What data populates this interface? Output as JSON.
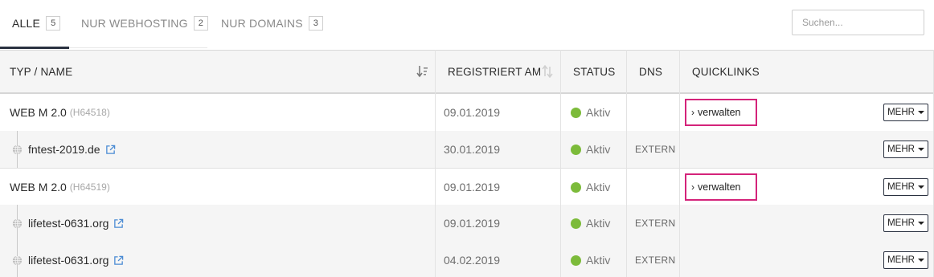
{
  "tabs": [
    {
      "label": "ALLE",
      "count": "5"
    },
    {
      "label": "NUR WEBHOSTING",
      "count": "2"
    },
    {
      "label": "NUR DOMAINS",
      "count": "3"
    }
  ],
  "search": {
    "placeholder": "Suchen..."
  },
  "columns": {
    "name": "TYP / NAME",
    "registered": "REGISTRIERT AM",
    "status": "STATUS",
    "dns": "DNS",
    "quicklinks": "QUICKLINKS"
  },
  "rows": [
    {
      "name": "WEB M 2.0",
      "code": "(H64518)",
      "date": "09.01.2019",
      "status": "Aktiv",
      "dns": "",
      "quicklink": "verwalten",
      "more": "MEHR"
    },
    {
      "name": "fntest-2019.de",
      "date": "30.01.2019",
      "status": "Aktiv",
      "dns": "EXTERN",
      "more": "MEHR"
    },
    {
      "name": "WEB M 2.0",
      "code": "(H64519)",
      "date": "09.01.2019",
      "status": "Aktiv",
      "dns": "",
      "quicklink": "verwalten",
      "more": "MEHR"
    },
    {
      "name": "lifetest-0631.org",
      "date": "09.01.2019",
      "status": "Aktiv",
      "dns": "EXTERN",
      "more": "MEHR"
    },
    {
      "name": "lifetest-0631.org",
      "date": "04.02.2019",
      "status": "Aktiv",
      "dns": "EXTERN",
      "more": "MEHR"
    }
  ],
  "colors": {
    "accent": "#d4237a",
    "status_active": "#7cbb3a",
    "nav_dark": "#2a3140"
  }
}
